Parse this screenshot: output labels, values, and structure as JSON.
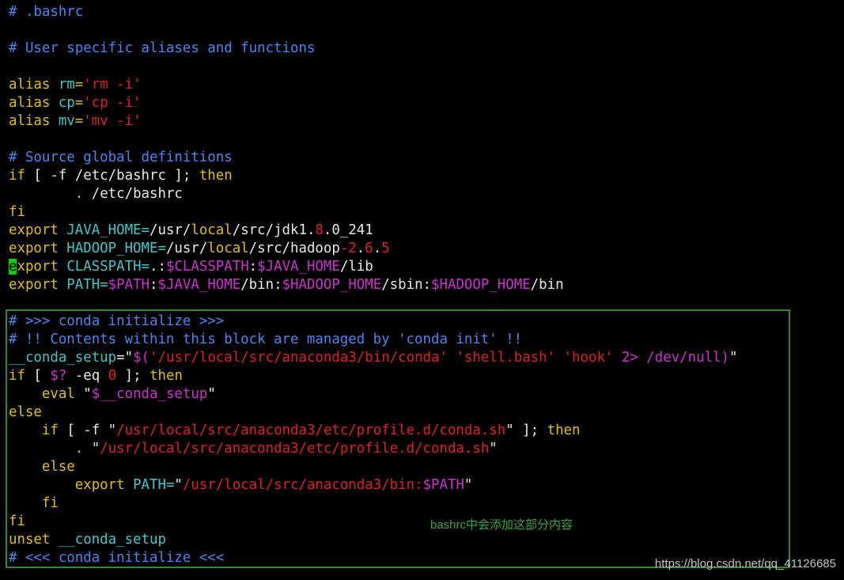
{
  "colors": {
    "background": "#000000",
    "comment": "#4a86f0",
    "keyword": "#e0c000",
    "variable": "#40c8c8",
    "string": "#e02020",
    "expansion": "#d030d0",
    "text": "#e8e8e8",
    "cursor": "#00d000",
    "box": "#2e8b2e"
  },
  "lines": [
    [
      {
        "t": "# .bashrc",
        "c": "cmt"
      }
    ],
    [],
    [
      {
        "t": "# User specific aliases and functions",
        "c": "cmt"
      }
    ],
    [],
    [
      {
        "t": "alias ",
        "c": "kw"
      },
      {
        "t": "rm",
        "c": "var"
      },
      {
        "t": "=",
        "c": "kw"
      },
      {
        "t": "'rm -i'",
        "c": "str"
      }
    ],
    [
      {
        "t": "alias ",
        "c": "kw"
      },
      {
        "t": "cp",
        "c": "var"
      },
      {
        "t": "=",
        "c": "kw"
      },
      {
        "t": "'cp -i'",
        "c": "str"
      }
    ],
    [
      {
        "t": "alias ",
        "c": "kw"
      },
      {
        "t": "mv",
        "c": "var"
      },
      {
        "t": "=",
        "c": "kw"
      },
      {
        "t": "'mv -i'",
        "c": "str"
      }
    ],
    [],
    [
      {
        "t": "# Source global definitions",
        "c": "cmt"
      }
    ],
    [
      {
        "t": "if",
        "c": "kw"
      },
      {
        "t": " [ -f /etc/bashrc ]; ",
        "c": "txt"
      },
      {
        "t": "then",
        "c": "kw"
      }
    ],
    [
      {
        "t": "        ",
        "c": "txt"
      },
      {
        "t": ".",
        "c": "kw"
      },
      {
        "t": " /etc/bashrc",
        "c": "txt"
      }
    ],
    [
      {
        "t": "fi",
        "c": "kw"
      }
    ],
    [
      {
        "t": "export ",
        "c": "kw"
      },
      {
        "t": "JAVA_HOME=",
        "c": "var"
      },
      {
        "t": "/usr/",
        "c": "txt"
      },
      {
        "t": "local",
        "c": "kw"
      },
      {
        "t": "/src/jdk1.",
        "c": "txt"
      },
      {
        "t": "8",
        "c": "str"
      },
      {
        "t": ".0_241",
        "c": "txt"
      }
    ],
    [
      {
        "t": "export ",
        "c": "kw"
      },
      {
        "t": "HADOOP_HOME=",
        "c": "var"
      },
      {
        "t": "/usr/",
        "c": "txt"
      },
      {
        "t": "local",
        "c": "kw"
      },
      {
        "t": "/src/hadoop",
        "c": "txt"
      },
      {
        "t": "-2",
        "c": "str"
      },
      {
        "t": ".",
        "c": "txt"
      },
      {
        "t": "6",
        "c": "str"
      },
      {
        "t": ".",
        "c": "txt"
      },
      {
        "t": "5",
        "c": "str"
      }
    ],
    [
      {
        "t": "e",
        "c": "cursor"
      },
      {
        "t": "xport ",
        "c": "kw"
      },
      {
        "t": "CLASSPATH=",
        "c": "var"
      },
      {
        "t": ".:",
        "c": "txt"
      },
      {
        "t": "$CLASSPATH",
        "c": "mag"
      },
      {
        "t": ":",
        "c": "txt"
      },
      {
        "t": "$JAVA_HOME",
        "c": "mag"
      },
      {
        "t": "/lib",
        "c": "txt"
      }
    ],
    [
      {
        "t": "export ",
        "c": "kw"
      },
      {
        "t": "PATH=",
        "c": "var"
      },
      {
        "t": "$PATH",
        "c": "mag"
      },
      {
        "t": ":",
        "c": "txt"
      },
      {
        "t": "$JAVA_HOME",
        "c": "mag"
      },
      {
        "t": "/bin:",
        "c": "txt"
      },
      {
        "t": "$HADOOP_HOME",
        "c": "mag"
      },
      {
        "t": "/sbin:",
        "c": "txt"
      },
      {
        "t": "$HADOOP_HOME",
        "c": "mag"
      },
      {
        "t": "/bin",
        "c": "txt"
      }
    ],
    [],
    [
      {
        "t": "# >>> conda initialize >>>",
        "c": "cmt"
      }
    ],
    [
      {
        "t": "# !! Contents within this block are managed by 'conda init' !!",
        "c": "cmt"
      }
    ],
    [
      {
        "t": "__conda_setup",
        "c": "var"
      },
      {
        "t": "=\"",
        "c": "txt"
      },
      {
        "t": "$(",
        "c": "mag"
      },
      {
        "t": "'/usr/local/src/anaconda3/bin/conda'",
        "c": "str"
      },
      {
        "t": " ",
        "c": "txt"
      },
      {
        "t": "'shell.bash'",
        "c": "str"
      },
      {
        "t": " ",
        "c": "txt"
      },
      {
        "t": "'hook'",
        "c": "str"
      },
      {
        "t": " ",
        "c": "txt"
      },
      {
        "t": "2>",
        "c": "mag"
      },
      {
        "t": " /dev/null)",
        "c": "mag"
      },
      {
        "t": "\"",
        "c": "txt"
      }
    ],
    [
      {
        "t": "if",
        "c": "kw"
      },
      {
        "t": " [ ",
        "c": "txt"
      },
      {
        "t": "$?",
        "c": "mag"
      },
      {
        "t": " -eq ",
        "c": "txt"
      },
      {
        "t": "0",
        "c": "str"
      },
      {
        "t": " ]; ",
        "c": "txt"
      },
      {
        "t": "then",
        "c": "kw"
      }
    ],
    [
      {
        "t": "    ",
        "c": "txt"
      },
      {
        "t": "eval",
        "c": "kw"
      },
      {
        "t": " \"",
        "c": "txt"
      },
      {
        "t": "$__conda_setup",
        "c": "mag"
      },
      {
        "t": "\"",
        "c": "txt"
      }
    ],
    [
      {
        "t": "else",
        "c": "kw"
      }
    ],
    [
      {
        "t": "    ",
        "c": "txt"
      },
      {
        "t": "if",
        "c": "kw"
      },
      {
        "t": " [ -f \"",
        "c": "txt"
      },
      {
        "t": "/usr/local/src/anaconda3/etc/profile.d/conda.sh",
        "c": "str"
      },
      {
        "t": "\" ]; ",
        "c": "txt"
      },
      {
        "t": "then",
        "c": "kw"
      }
    ],
    [
      {
        "t": "        ",
        "c": "txt"
      },
      {
        "t": ".",
        "c": "kw"
      },
      {
        "t": " \"",
        "c": "txt"
      },
      {
        "t": "/usr/local/src/anaconda3/etc/profile.d/conda.sh",
        "c": "str"
      },
      {
        "t": "\"",
        "c": "txt"
      }
    ],
    [
      {
        "t": "    ",
        "c": "txt"
      },
      {
        "t": "else",
        "c": "kw"
      }
    ],
    [
      {
        "t": "        ",
        "c": "txt"
      },
      {
        "t": "export ",
        "c": "kw"
      },
      {
        "t": "PATH=",
        "c": "var"
      },
      {
        "t": "\"",
        "c": "txt"
      },
      {
        "t": "/usr/local/src/anaconda3/bin:",
        "c": "str"
      },
      {
        "t": "$PATH",
        "c": "mag"
      },
      {
        "t": "\"",
        "c": "txt"
      }
    ],
    [
      {
        "t": "    ",
        "c": "txt"
      },
      {
        "t": "fi",
        "c": "kw"
      }
    ],
    [
      {
        "t": "fi",
        "c": "kw"
      }
    ],
    [
      {
        "t": "unset ",
        "c": "kw"
      },
      {
        "t": "__conda_setup",
        "c": "var"
      }
    ],
    [
      {
        "t": "# <<< conda initialize <<<",
        "c": "cmt"
      }
    ]
  ],
  "annotation": "bashrc中会添加这部分内容",
  "watermark": "https://blog.csdn.net/qq_41126685"
}
